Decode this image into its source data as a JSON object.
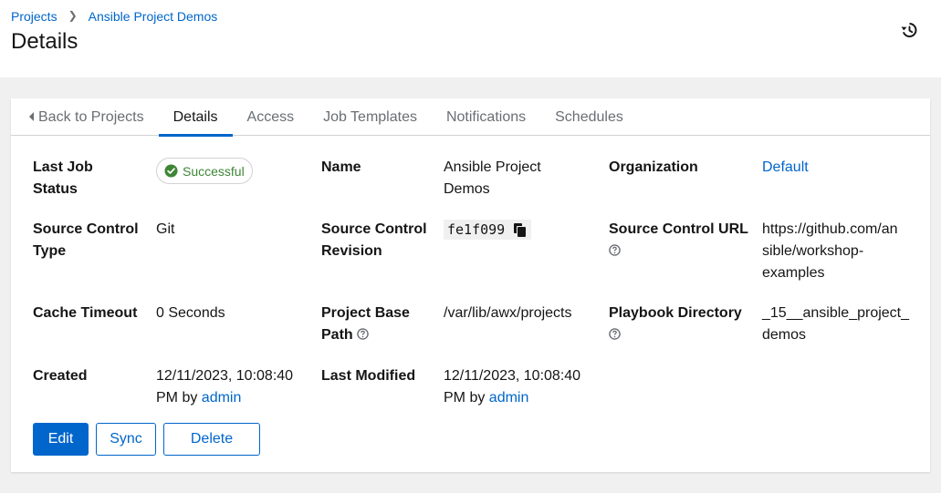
{
  "breadcrumb": {
    "projects": "Projects",
    "current": "Ansible Project Demos"
  },
  "page_title": "Details",
  "tabs": {
    "back": "Back to Projects",
    "details": "Details",
    "access": "Access",
    "job_templates": "Job Templates",
    "notifications": "Notifications",
    "schedules": "Schedules"
  },
  "details": {
    "last_job_status": {
      "label_1": "Last Job",
      "label_2": "Status",
      "value": "Successful"
    },
    "name": {
      "label": "Name",
      "value_1": "Ansible Project",
      "value_2": "Demos"
    },
    "organization": {
      "label": "Organization",
      "value": "Default"
    },
    "scm_type": {
      "label_1": "Source Control",
      "label_2": "Type",
      "value": "Git"
    },
    "scm_revision": {
      "label_1": "Source Control",
      "label_2": "Revision",
      "value": "fe1f099"
    },
    "scm_url": {
      "label": "Source Control URL",
      "value_1": "https://github.com/an",
      "value_2": "sible/workshop-",
      "value_3": "examples"
    },
    "cache_timeout": {
      "label": "Cache Timeout",
      "value": "0 Seconds"
    },
    "base_path": {
      "label_1": "Project Base",
      "label_2": "Path",
      "value": "/var/lib/awx/projects"
    },
    "playbook_dir": {
      "label": "Playbook Directory",
      "value_1": "_15__ansible_project_",
      "value_2": "demos"
    },
    "created": {
      "label": "Created",
      "value_1": "12/11/2023, 10:08:40",
      "value_2": "PM by",
      "user": "admin"
    },
    "last_modified": {
      "label": "Last Modified",
      "value_1": "12/11/2023, 10:08:40",
      "value_2": "PM by",
      "user": "admin"
    }
  },
  "buttons": {
    "edit": "Edit",
    "sync": "Sync",
    "delete": "Delete"
  },
  "colors": {
    "primary": "#0066cc",
    "success": "#3e8635",
    "muted": "#6a6e73"
  },
  "icons": [
    "history-icon",
    "caret-left-icon",
    "check-circle-icon",
    "copy-icon",
    "help-icon"
  ]
}
